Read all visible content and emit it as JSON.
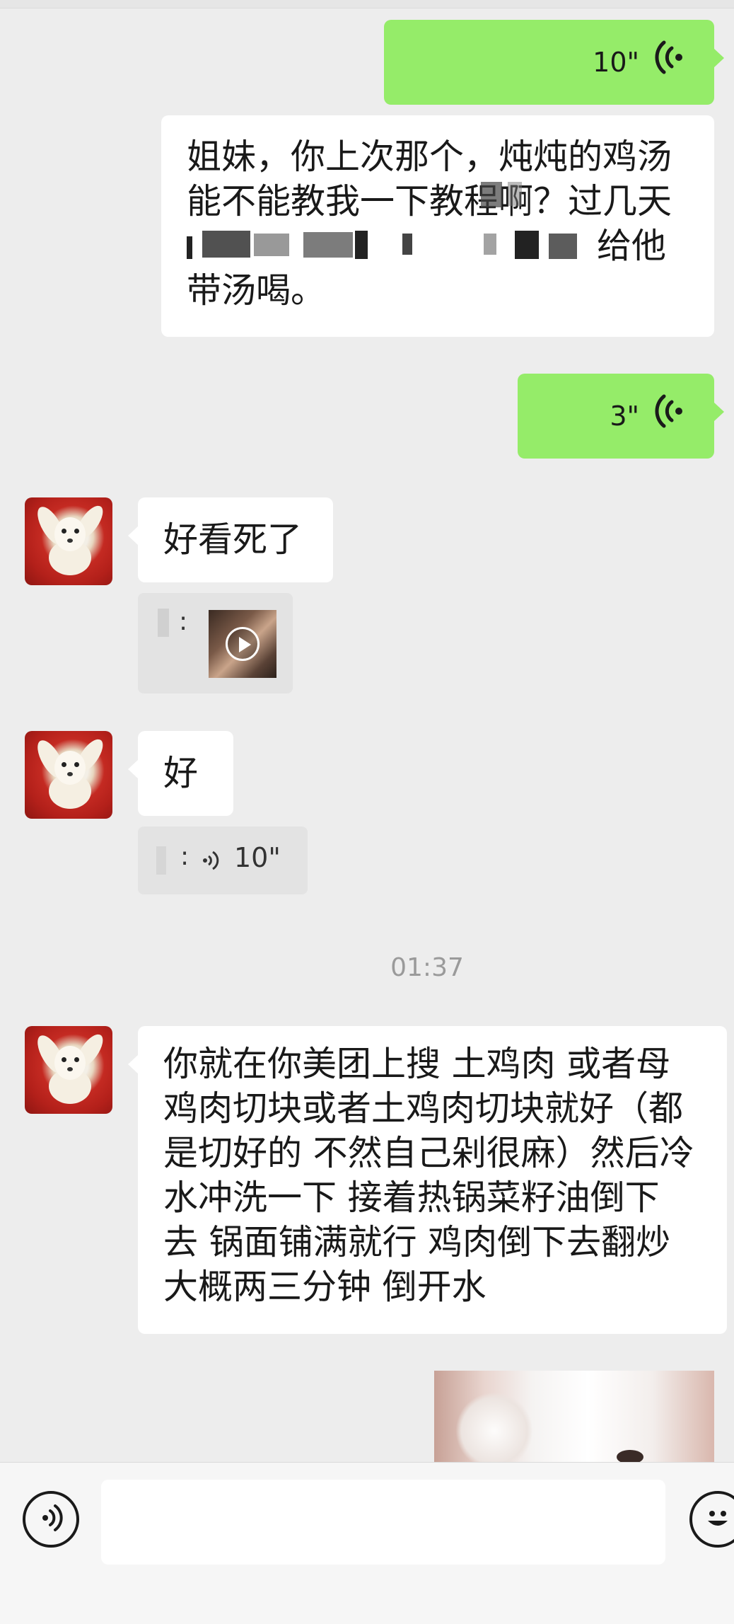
{
  "messages": {
    "voice1": {
      "duration": "10\""
    },
    "text1": {
      "line1": "姐妹，你上次那个，炖炖的鸡汤",
      "line2": "能不能教我一下教程啊？过几天",
      "line3_end": "给他",
      "line4": "带汤喝。"
    },
    "voice2": {
      "duration": "3\""
    },
    "reply1": {
      "text": "好看死了"
    },
    "quote1": {
      "prefix": ":"
    },
    "reply2": {
      "text": "好"
    },
    "quote2": {
      "prefix": ":",
      "duration": "10\""
    },
    "time": "01:37",
    "reply3": {
      "lines": [
        "你就在你美团上搜 土鸡肉 或者母",
        "鸡肉切块或者土鸡肉切块就好（都",
        "是切好的 不然自己剁很麻）然后冷",
        "水冲洗一下 接着热锅菜籽油倒下",
        "去 锅面铺满就行 鸡肉倒下去翻炒",
        "大概两三分钟 倒开水"
      ]
    }
  },
  "input_bar": {
    "voice_button_icon": "voice-mode-icon",
    "emoji_button_icon": "emoji-icon",
    "text_value": ""
  },
  "colors": {
    "my_bubble": "#95ec69",
    "their_bubble": "#ffffff",
    "background": "#ededed"
  }
}
